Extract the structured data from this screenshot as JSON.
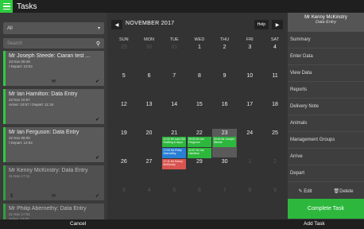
{
  "app": {
    "title": "Tasks"
  },
  "left": {
    "filter_value": "All",
    "search_placeholder": "Search",
    "tasks": [
      {
        "title": "Mr Joseph Steede: Ciaran test ...",
        "line1": "23 Nov 09:49",
        "line2": "/ Depart: 10:03",
        "icons": [
          "envelope-icon",
          "check-icon"
        ]
      },
      {
        "title": "Mr Ian Hamilton: Data Entry",
        "line1": "22 Nov 10:57",
        "line2": "Arrive: 10:57 / Depart: 11:34",
        "icons": [
          "check-icon"
        ]
      },
      {
        "title": "Mr Ian Ferguson: Data Entry",
        "line1": "22 Nov 09:00",
        "line2": "/ Depart: 12:03",
        "icons": [
          "check-icon"
        ]
      },
      {
        "title": "Mr Kenny McKinstry: Data Entry",
        "line1": "21 Nov 17:11",
        "line2": "",
        "icons": [
          "dollar-icon",
          "envelope-icon",
          "check-icon"
        ]
      },
      {
        "title": "Mr Philip Abernethy: Data Entry",
        "line1": "21 Nov 17:02",
        "line2": "Arrive: 17:02",
        "icons": []
      }
    ]
  },
  "calendar": {
    "month": "NOVEMBER 2017",
    "help_label": "Help",
    "prev": "◀",
    "next": "▶",
    "days_of_week": [
      "SUN",
      "MON",
      "TUE",
      "WED",
      "THU",
      "FRI",
      "SAT"
    ],
    "weeks": [
      [
        "29",
        "30",
        "31",
        "1",
        "2",
        "3",
        "4"
      ],
      [
        "5",
        "6",
        "7",
        "8",
        "9",
        "10",
        "11"
      ],
      [
        "12",
        "13",
        "14",
        "15",
        "16",
        "17",
        "18"
      ],
      [
        "19",
        "20",
        "21",
        "22",
        "23",
        "24",
        "25"
      ],
      [
        "26",
        "27",
        "28",
        "29",
        "30",
        "1",
        "2"
      ],
      [
        "3",
        "4",
        "5",
        "6",
        "7",
        "8",
        "9"
      ]
    ],
    "events": [
      {
        "day": "21",
        "text": "11:02 Mr Ivan Gill Grafting & Aquo",
        "color": "#2db83d"
      },
      {
        "day": "21",
        "text": "17:02 Mr Philip Abernethy",
        "color": "#2a7fd4"
      },
      {
        "day": "21",
        "text": "17:11 Mr Kenny McKinstry",
        "color": "#d9534f"
      },
      {
        "day": "22",
        "text": "09:00 Mr Ian Ferguson",
        "color": "#2db83d"
      },
      {
        "day": "22",
        "text": "10:57 Mr Ian Hamilton",
        "color": "#2db83d"
      },
      {
        "day": "23",
        "text": "09:49 Mr Joseph Steede",
        "color": "#2db83d"
      }
    ]
  },
  "right": {
    "user_name": "Mr Kenny McKinstry",
    "user_sub": "Data Entry",
    "menu": [
      "Summary",
      "Enter Data",
      "View Data",
      "Reports",
      "Delivery Note",
      "Animals",
      "Management Groups",
      "Arrive",
      "Depart"
    ],
    "edit_label": "Edit",
    "delete_label": "Delete",
    "complete_label": "Complete Task"
  },
  "bottom": {
    "cancel": "Cancel",
    "add_task": "Add Task"
  },
  "colors": {
    "accent": "#2ecc40",
    "selected_day": "#5a5a5a"
  }
}
